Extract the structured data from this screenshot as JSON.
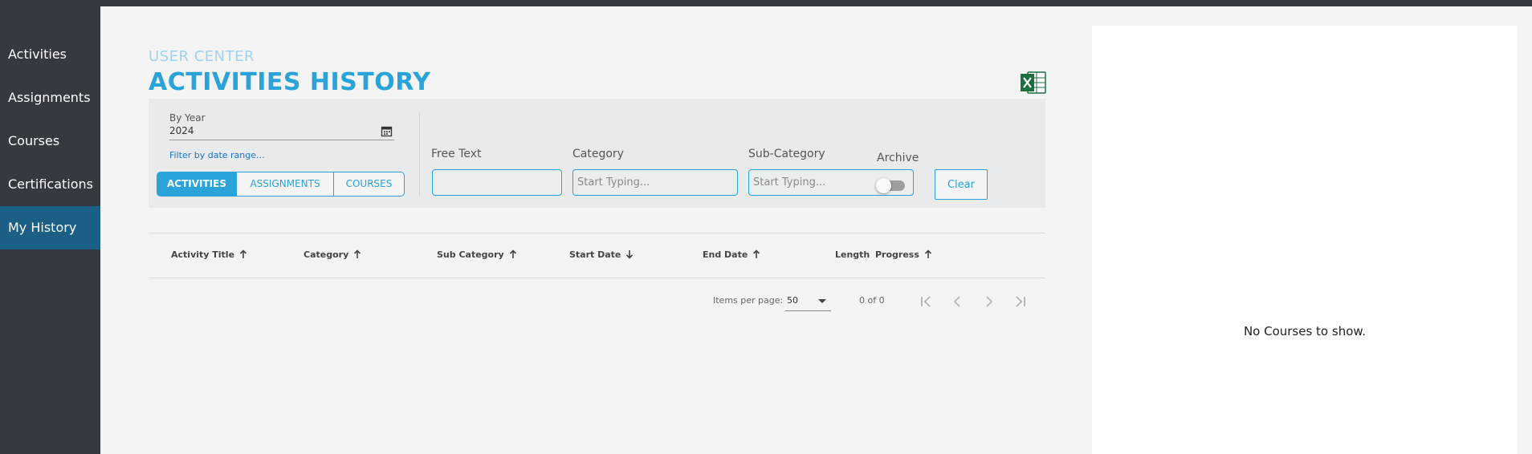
{
  "sidebar": {
    "items": [
      {
        "label": "Activities",
        "active": false
      },
      {
        "label": "Assignments",
        "active": false
      },
      {
        "label": "Courses",
        "active": false
      },
      {
        "label": "Certifications",
        "active": false
      },
      {
        "label": "My History",
        "active": true
      }
    ]
  },
  "header": {
    "eyebrow": "USER CENTER",
    "title": "ACTIVITIES HISTORY",
    "export_icon": "excel-icon"
  },
  "filters": {
    "year_label": "By Year",
    "year_value": "2024",
    "date_range_link": "Filter by date range...",
    "type_tabs": [
      "ACTIVITIES",
      "ASSIGNMENTS",
      "COURSES"
    ],
    "selected_type": "ACTIVITIES",
    "free_text_label": "Free Text",
    "free_text_value": "",
    "category_label": "Category",
    "category_placeholder": "Start Typing...",
    "subcategory_label": "Sub-Category",
    "subcategory_placeholder": "Start Typing...",
    "archive_label": "Archive",
    "archive_on": false,
    "clear_label": "Clear"
  },
  "table": {
    "columns": [
      {
        "label": "Activity Title",
        "sort": "asc"
      },
      {
        "label": "Category",
        "sort": "asc"
      },
      {
        "label": "Sub Category",
        "sort": "asc"
      },
      {
        "label": "Start Date",
        "sort": "desc"
      },
      {
        "label": "End Date",
        "sort": "asc"
      },
      {
        "label": "Length",
        "sort": "none"
      },
      {
        "label": "Progress",
        "sort": "asc"
      }
    ],
    "rows": []
  },
  "pagination": {
    "items_per_page_label": "Items per page:",
    "items_per_page": "50",
    "range": "0 of 0"
  },
  "right_panel": {
    "empty_message": "No Courses to show."
  },
  "colors": {
    "sidebar_bg": "#343a40",
    "active_nav": "#1b5f86",
    "accent": "#29a3da",
    "excel_green": "#1d6f42"
  }
}
